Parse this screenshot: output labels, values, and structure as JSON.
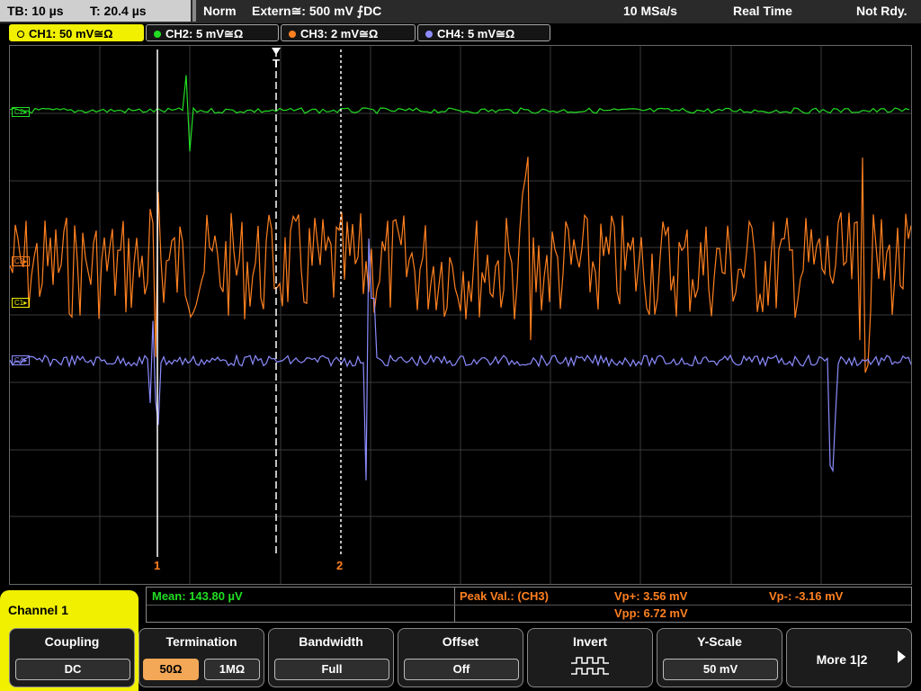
{
  "status": {
    "timebase": "TB: 10 µs",
    "trigger_time": "T: 20.4 µs",
    "mode": "Norm",
    "trigger_source": "Extern≅: 500 mV ⨍DC",
    "sample_rate": "10 MSa/s",
    "acq_mode": "Real Time",
    "ready_state": "Not Rdy."
  },
  "channels": [
    {
      "label": "CH1: 50 mV≅Ω",
      "color": "#f0f000",
      "active": true
    },
    {
      "label": "CH2: 5 mV≅Ω",
      "color": "#22dd22",
      "active": false
    },
    {
      "label": "CH3: 2 mV≅Ω",
      "color": "#ff8020",
      "active": false
    },
    {
      "label": "CH4: 5 mV≅Ω",
      "color": "#8c8cff",
      "active": false
    }
  ],
  "markers": {
    "ch2": "C2▸",
    "ch3": "C3▸",
    "ch1": "C1▸",
    "ch4": "C4▸",
    "cursor1": "1",
    "cursor2": "2",
    "trigger": "T"
  },
  "measurements": {
    "mean": "Mean: 143.80 µV",
    "peak_label": "Peak Val.:  (CH3)",
    "vp_plus": "Vp+: 3.56 mV",
    "vp_minus": "Vp-: -3.16 mV",
    "vpp": "Vpp: 6.72 mV"
  },
  "menu": {
    "title": "Channel 1",
    "coupling": {
      "label": "Coupling",
      "value": "DC"
    },
    "termination": {
      "label": "Termination",
      "opt1": "50Ω",
      "opt2": "1MΩ"
    },
    "bandwidth": {
      "label": "Bandwidth",
      "value": "Full"
    },
    "offset": {
      "label": "Offset",
      "value": "Off"
    },
    "invert": {
      "label": "Invert"
    },
    "yscale": {
      "label": "Y-Scale",
      "value": "50 mV"
    },
    "more": {
      "label": "More 1|2"
    }
  },
  "colors": {
    "ch1": "#f0f000",
    "ch2": "#22dd22",
    "ch3": "#ff8020",
    "ch4": "#8c8cff",
    "measure_green": "#22dd22",
    "measure_orange": "#ff8020"
  }
}
